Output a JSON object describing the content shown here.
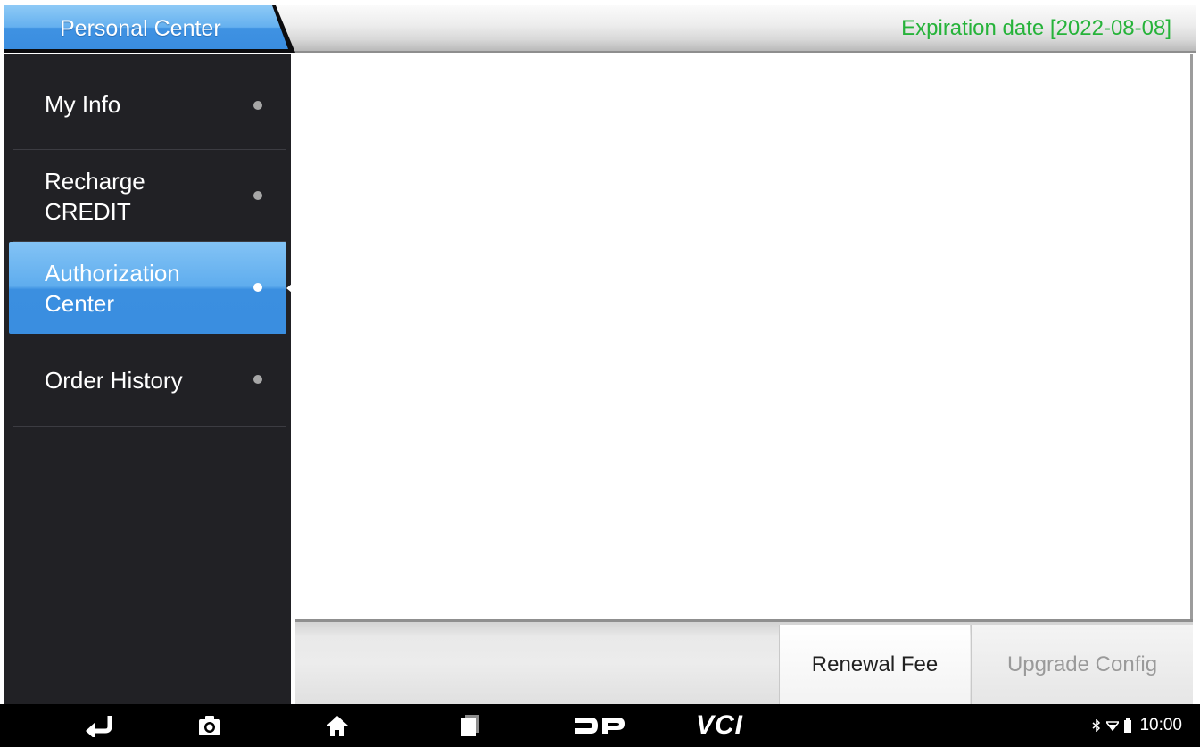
{
  "header": {
    "title": "Personal Center",
    "expiration": "Expiration date [2022-08-08]",
    "expiration_color": "#26b33a",
    "accent_color": "#3f92e2"
  },
  "sidebar": {
    "items": [
      {
        "label": "My Info",
        "active": false
      },
      {
        "label": "Recharge\nCREDIT",
        "active": false
      },
      {
        "label": "Authorization\nCenter",
        "active": true
      },
      {
        "label": "Order History",
        "active": false
      }
    ]
  },
  "actions": {
    "renewal_label": "Renewal Fee",
    "upgrade_label": "Upgrade Config",
    "upgrade_enabled": false
  },
  "navbar": {
    "icons": [
      "back-icon",
      "screenshot-camera-icon",
      "home-icon",
      "recent-apps-icon",
      "dp-logo-icon"
    ],
    "vci_label": "VCI",
    "status_icons": [
      "bluetooth-icon",
      "wifi-icon",
      "battery-icon"
    ],
    "time": "10:00"
  }
}
